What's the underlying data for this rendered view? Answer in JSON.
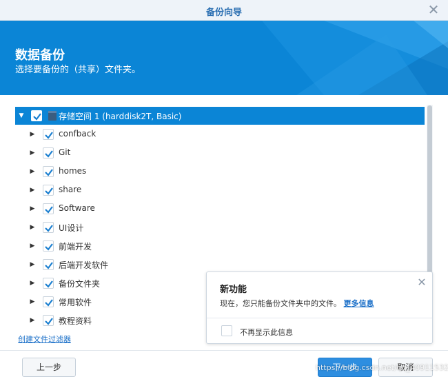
{
  "window": {
    "title": "备份向导"
  },
  "banner": {
    "heading": "数据备份",
    "subheading": "选择要备份的（共享）文件夹。"
  },
  "tree": {
    "root": {
      "label": "存储空间 1 (harddisk2T, Basic)",
      "checked": true,
      "expanded": true
    },
    "items": [
      {
        "label": "confback",
        "checked": true
      },
      {
        "label": "Git",
        "checked": true
      },
      {
        "label": "homes",
        "checked": true
      },
      {
        "label": "share",
        "checked": true
      },
      {
        "label": "Software",
        "checked": true
      },
      {
        "label": "UI设计",
        "checked": true
      },
      {
        "label": "前端开发",
        "checked": true
      },
      {
        "label": "后端开发软件",
        "checked": true
      },
      {
        "label": "备份文件夹",
        "checked": true
      },
      {
        "label": "常用软件",
        "checked": true
      },
      {
        "label": "教程资料",
        "checked": true
      }
    ]
  },
  "filter_link": "创建文件过滤器",
  "popup": {
    "title": "新功能",
    "message": "现在，您只能备份文件夹中的文件。",
    "more_link": "更多信息",
    "checkbox_label": "不再显示此信息"
  },
  "buttons": {
    "prev": "上一步",
    "next": "下一步",
    "cancel": "取消"
  },
  "watermark": "https://blog.csdn.net/qq_40911532",
  "colors": {
    "accent": "#0b85d6",
    "link": "#1a6fc8",
    "primary_button": "#2e8ee0"
  }
}
